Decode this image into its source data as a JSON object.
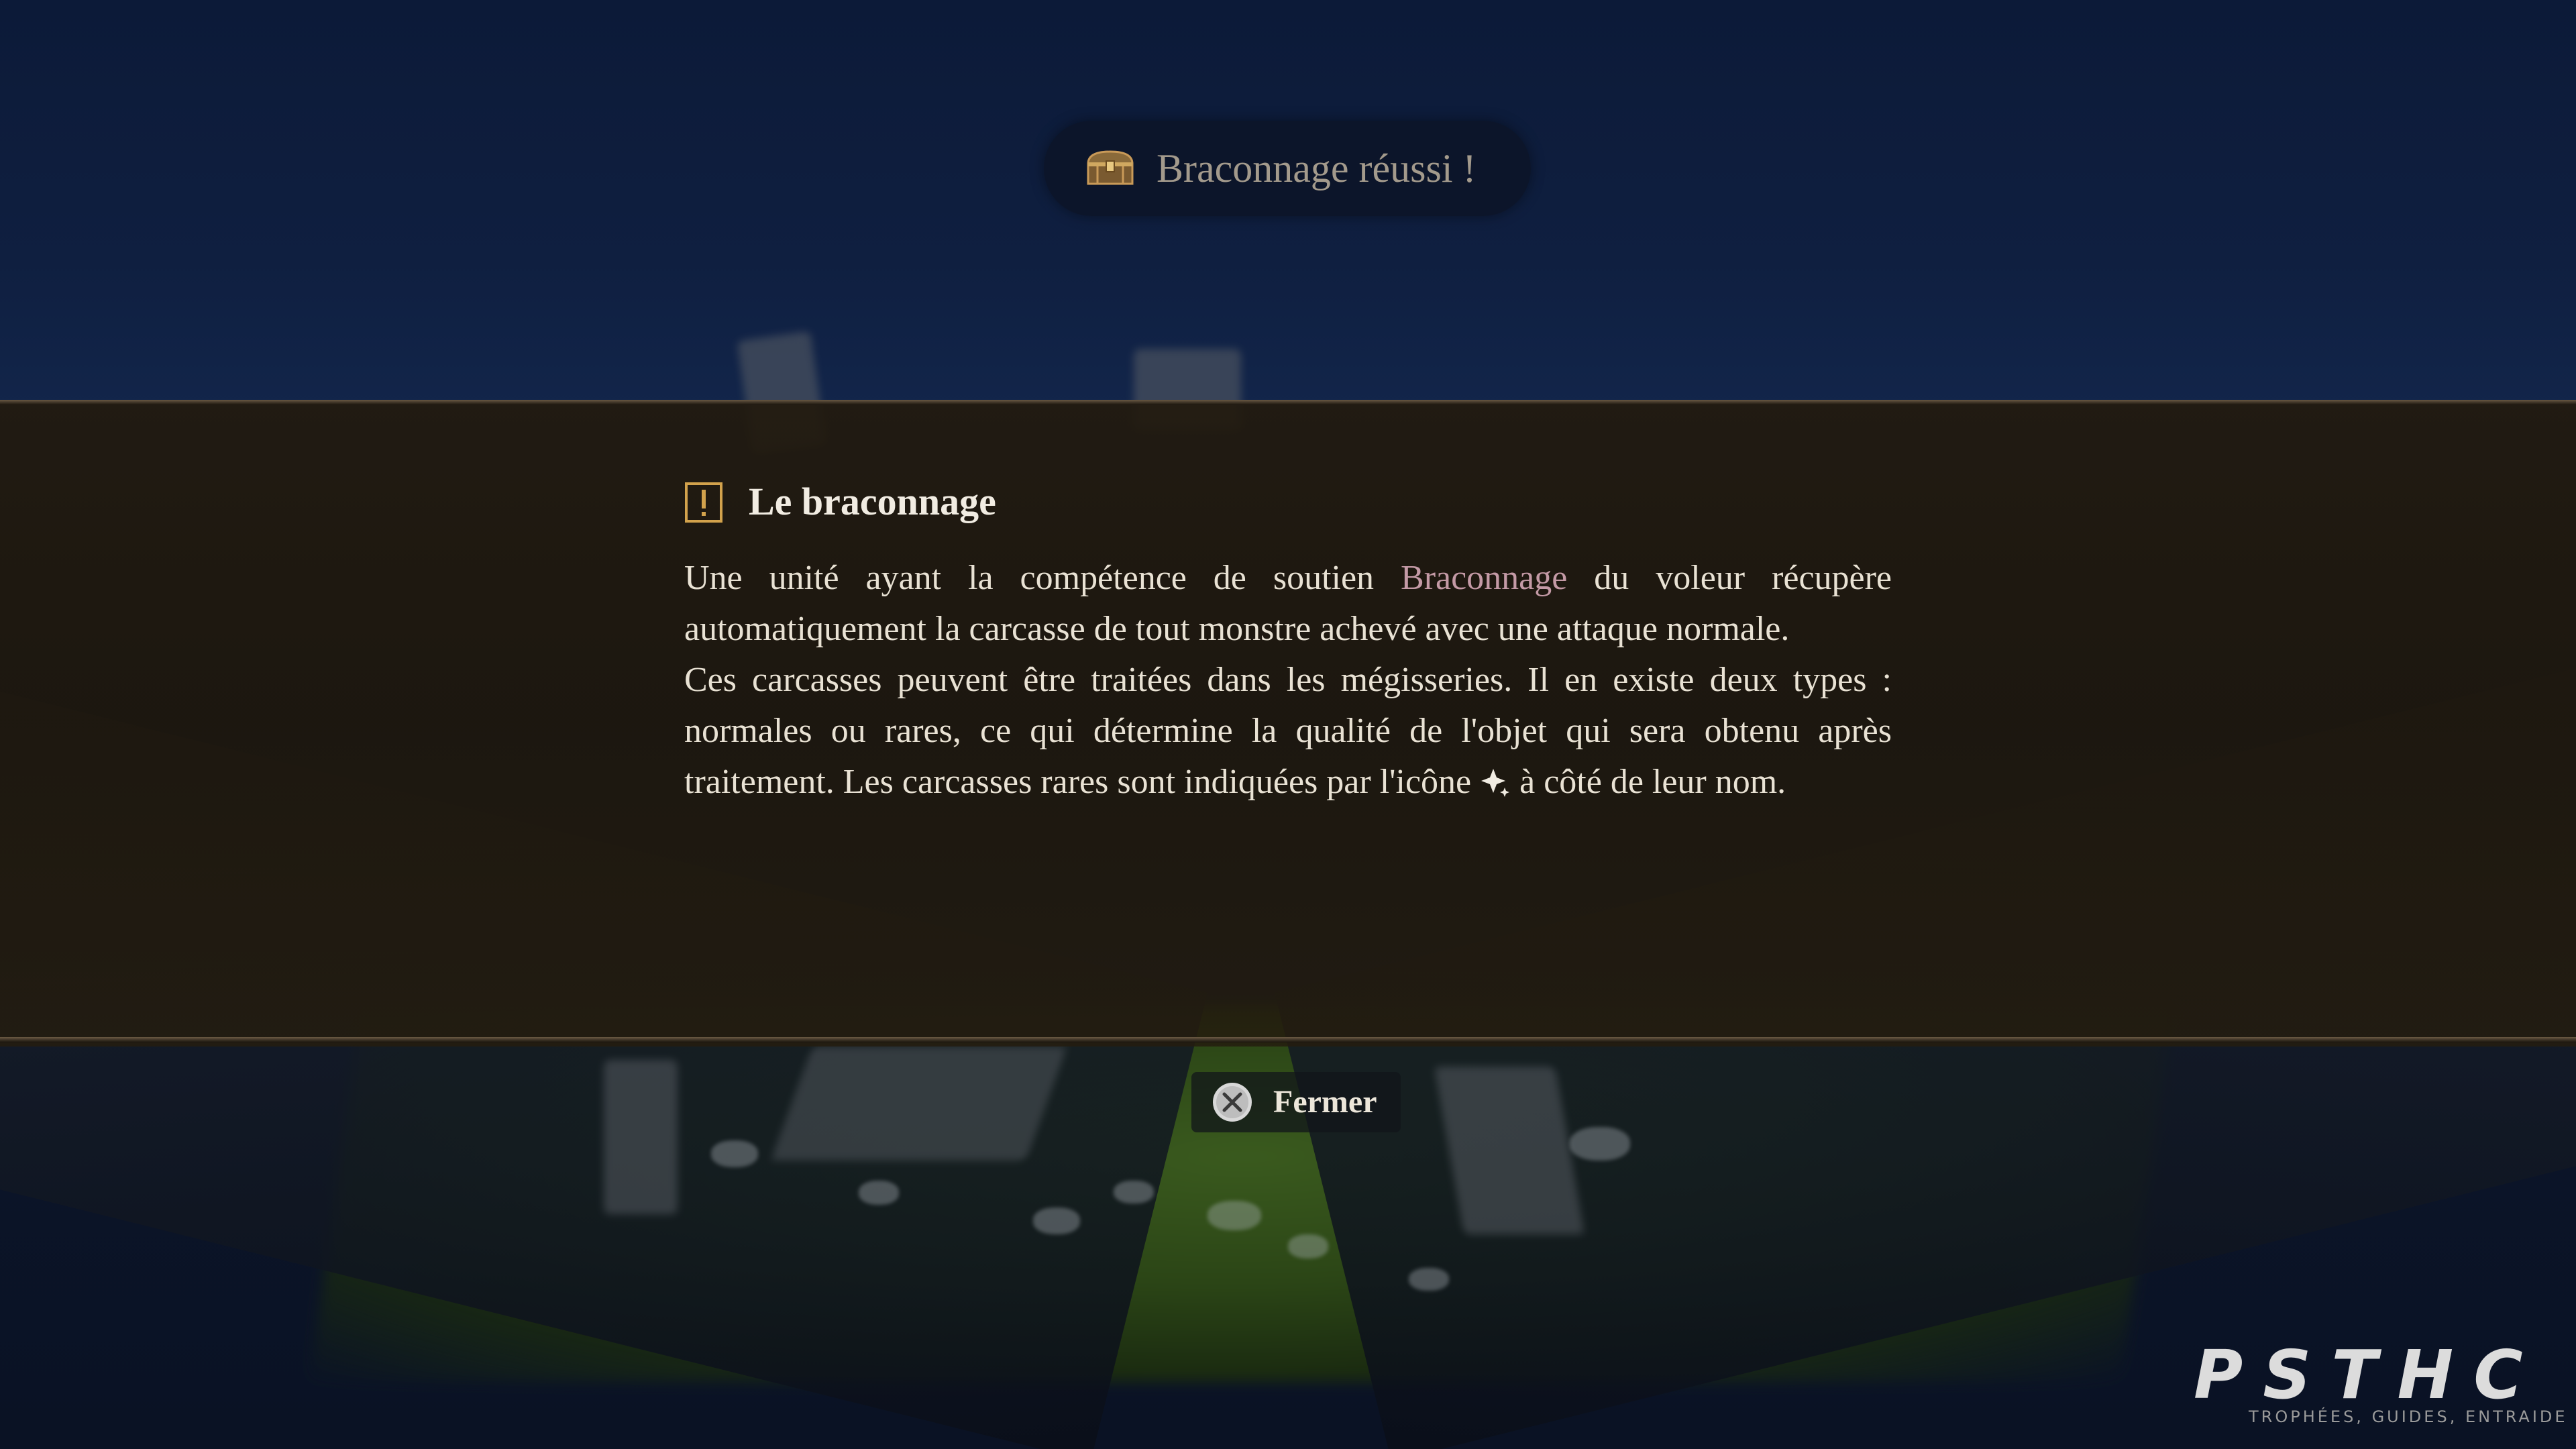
{
  "colors": {
    "panel_bg": "#221a0e",
    "title_text": "#f1ece2",
    "body_text": "#e9e2d4",
    "highlight": "#c49aa6",
    "notification_text": "#a39a8c",
    "icon_gold": "#d2a24c"
  },
  "notification": {
    "icon": "treasure-chest-icon",
    "text": "Braconnage réussi !"
  },
  "tutorial": {
    "icon": "exclamation-icon",
    "title": "Le braconnage",
    "para1": {
      "before": "Une unité ayant la compétence de soutien ",
      "highlight": "Braconnage",
      "after": " du voleur récupère automatiquement la carcasse de tout monstre achevé avec une attaque normale."
    },
    "para2": {
      "before": "Ces carcasses peuvent être traitées dans les mégisseries. Il en existe deux types : normales ou rares, ce qui détermine la qualité de l'objet qui sera obtenu après traitement. Les carcasses rares sont indiquées par l'icône ",
      "icon": "rare-sparkle-icon",
      "after": " à côté de leur nom."
    }
  },
  "close_prompt": {
    "icon": "cross-button-icon",
    "label": "Fermer"
  },
  "watermark": {
    "logo": "PSTHC",
    "tagline": "TROPHÉES, GUIDES, ENTRAIDE"
  }
}
